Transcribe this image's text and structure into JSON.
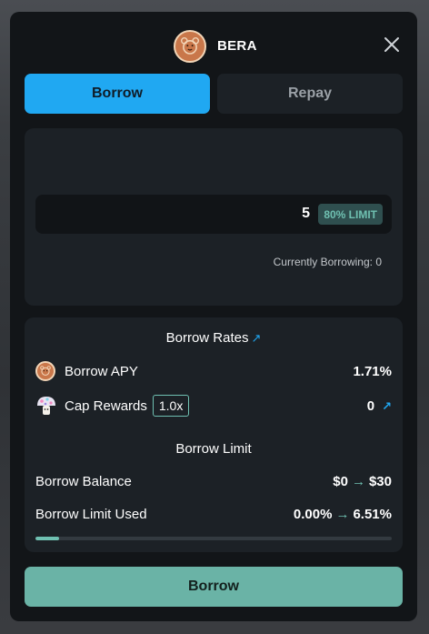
{
  "header": {
    "token_name": "BERA",
    "token_icon": "bear-icon",
    "close_icon": "close-icon"
  },
  "tabs": [
    {
      "label": "Borrow",
      "active": true
    },
    {
      "label": "Repay",
      "active": false
    }
  ],
  "input": {
    "amount": "5",
    "limit_badge": "80% LIMIT",
    "currently_borrowing": "Currently Borrowing: 0"
  },
  "rates": {
    "title": "Borrow Rates",
    "link_icon": "arrow-up-right-icon",
    "apy_label": "Borrow APY",
    "apy_value": "1.71%",
    "rewards_label": "Cap Rewards",
    "rewards_multiplier": "1.0x",
    "rewards_value": "0",
    "rewards_icon": "mushroom-icon"
  },
  "limit": {
    "title": "Borrow Limit",
    "balance_label": "Borrow Balance",
    "balance_from": "$0",
    "balance_to": "$30",
    "used_label": "Borrow Limit Used",
    "used_from": "0.00%",
    "used_to": "6.51%",
    "used_fraction": 0.0651
  },
  "arrow_glyph": "→",
  "link_glyph": "↗",
  "submit_label": "Borrow",
  "colors": {
    "accent": "#20a8f2",
    "teal": "#6fc0b1",
    "panel": "#1c2126",
    "modal": "#121518"
  }
}
